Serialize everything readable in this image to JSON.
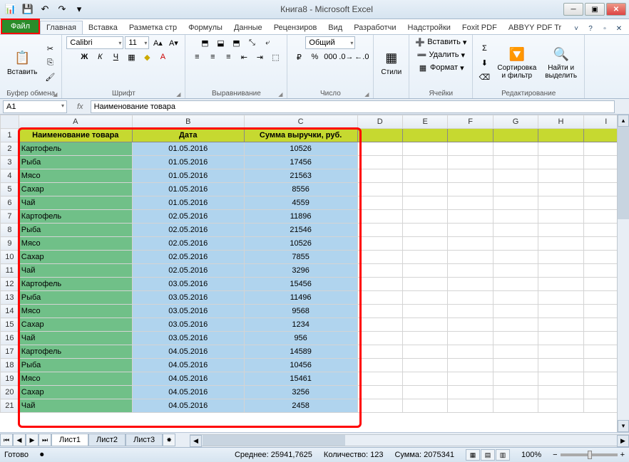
{
  "title": "Книга8 - Microsoft Excel",
  "qat": {
    "save": "💾",
    "undo": "↶",
    "redo": "↷",
    "more": "▾"
  },
  "tabs": {
    "file": "Файл",
    "items": [
      "Главная",
      "Вставка",
      "Разметка стр",
      "Формулы",
      "Данные",
      "Рецензиров",
      "Вид",
      "Разработчи",
      "Надстройки",
      "Foxit PDF",
      "ABBYY PDF Tr"
    ]
  },
  "ribbon": {
    "clipboard": {
      "paste": "Вставить",
      "label": "Буфер обмена"
    },
    "font": {
      "name": "Calibri",
      "size": "11",
      "label": "Шрифт"
    },
    "align": {
      "label": "Выравнивание"
    },
    "number": {
      "format": "Общий",
      "label": "Число"
    },
    "styles": {
      "btn": "Стили"
    },
    "cells": {
      "insert": "Вставить",
      "delete": "Удалить",
      "format": "Формат",
      "label": "Ячейки"
    },
    "editing": {
      "sort": "Сортировка\nи фильтр",
      "find": "Найти и\nвыделить",
      "label": "Редактирование"
    }
  },
  "namebox": "A1",
  "formula": "Наименование товара",
  "columns": [
    "A",
    "B",
    "C",
    "D",
    "E",
    "F",
    "G",
    "H",
    "I"
  ],
  "headers": [
    "Наименование товара",
    "Дата",
    "Сумма выручки, руб."
  ],
  "rows": [
    {
      "r": 2,
      "name": "Картофель",
      "date": "01.05.2016",
      "sum": "10526"
    },
    {
      "r": 3,
      "name": "Рыба",
      "date": "01.05.2016",
      "sum": "17456"
    },
    {
      "r": 4,
      "name": "Мясо",
      "date": "01.05.2016",
      "sum": "21563"
    },
    {
      "r": 5,
      "name": "Сахар",
      "date": "01.05.2016",
      "sum": "8556"
    },
    {
      "r": 6,
      "name": "Чай",
      "date": "01.05.2016",
      "sum": "4559"
    },
    {
      "r": 7,
      "name": "Картофель",
      "date": "02.05.2016",
      "sum": "11896"
    },
    {
      "r": 8,
      "name": "Рыба",
      "date": "02.05.2016",
      "sum": "21546"
    },
    {
      "r": 9,
      "name": "Мясо",
      "date": "02.05.2016",
      "sum": "10526"
    },
    {
      "r": 10,
      "name": "Сахар",
      "date": "02.05.2016",
      "sum": "7855"
    },
    {
      "r": 11,
      "name": "Чай",
      "date": "02.05.2016",
      "sum": "3296"
    },
    {
      "r": 12,
      "name": "Картофель",
      "date": "03.05.2016",
      "sum": "15456"
    },
    {
      "r": 13,
      "name": "Рыба",
      "date": "03.05.2016",
      "sum": "11496"
    },
    {
      "r": 14,
      "name": "Мясо",
      "date": "03.05.2016",
      "sum": "9568"
    },
    {
      "r": 15,
      "name": "Сахар",
      "date": "03.05.2016",
      "sum": "1234"
    },
    {
      "r": 16,
      "name": "Чай",
      "date": "03.05.2016",
      "sum": "956"
    },
    {
      "r": 17,
      "name": "Картофель",
      "date": "04.05.2016",
      "sum": "14589"
    },
    {
      "r": 18,
      "name": "Рыба",
      "date": "04.05.2016",
      "sum": "10456"
    },
    {
      "r": 19,
      "name": "Мясо",
      "date": "04.05.2016",
      "sum": "15461"
    },
    {
      "r": 20,
      "name": "Сахар",
      "date": "04.05.2016",
      "sum": "3256"
    },
    {
      "r": 21,
      "name": "Чай",
      "date": "04.05.2016",
      "sum": "2458"
    }
  ],
  "sheets": [
    "Лист1",
    "Лист2",
    "Лист3"
  ],
  "status": {
    "ready": "Готово",
    "avg_label": "Среднее:",
    "avg": "25941,7625",
    "count_label": "Количество:",
    "count": "123",
    "sum_label": "Сумма:",
    "sum": "2075341",
    "zoom": "100%"
  }
}
